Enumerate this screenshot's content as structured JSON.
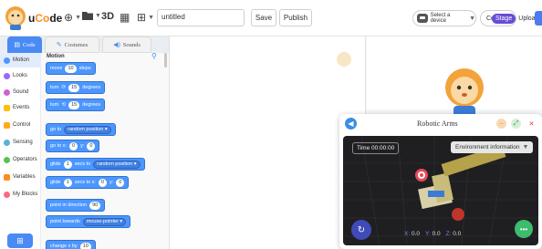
{
  "app": {
    "logo_prefix": "u",
    "logo_mid": "Co",
    "logo_suffix": "de"
  },
  "toolbar": {
    "view_3d_label": "3D",
    "project_title": "untitled",
    "save_label": "Save",
    "publish_label": "Publish",
    "device_label": "Select a device",
    "connect_label": "Connect",
    "mode_stage_label": "Stage",
    "mode_upload_label": "Upload"
  },
  "tabs": [
    {
      "label": "Code",
      "icon": "code-icon",
      "active": true
    },
    {
      "label": "Costumes",
      "icon": "brush-icon",
      "active": false
    },
    {
      "label": "Sounds",
      "icon": "speaker-icon",
      "active": false
    }
  ],
  "categories": [
    {
      "label": "Motion",
      "color": "#4c97ff",
      "active": true
    },
    {
      "label": "Looks",
      "color": "#9966ff",
      "active": false
    },
    {
      "label": "Sound",
      "color": "#cf63cf",
      "active": false
    },
    {
      "label": "Events",
      "color": "#ffbf00",
      "active": false
    },
    {
      "label": "Control",
      "color": "#ffab19",
      "active": false
    },
    {
      "label": "Sensing",
      "color": "#5cb1d6",
      "active": false
    },
    {
      "label": "Operators",
      "color": "#59c059",
      "active": false
    },
    {
      "label": "Variables",
      "color": "#ff8c1a",
      "active": false
    },
    {
      "label": "My Blocks",
      "color": "#ff6680",
      "active": false
    }
  ],
  "palette": {
    "header": "Motion",
    "blocks": {
      "move": {
        "text1": "move",
        "value": "10",
        "text2": "steps"
      },
      "turn_right": {
        "text1": "turn",
        "icon": "⟳",
        "value": "15",
        "text2": "degrees"
      },
      "turn_left": {
        "text1": "turn",
        "icon": "⟲",
        "value": "15",
        "text2": "degrees"
      },
      "goto": {
        "text1": "go to",
        "dropdown": "random position"
      },
      "goto_xy": {
        "text1": "go to x:",
        "x": "0",
        "text2": "y:",
        "y": "0"
      },
      "glide_to": {
        "text1": "glide",
        "secs": "1",
        "text2": "secs to",
        "dropdown": "random position"
      },
      "glide_xy": {
        "text1": "glide",
        "secs": "1",
        "text2": "secs to x:",
        "x": "0",
        "text3": "y:",
        "y": "0"
      },
      "point_dir": {
        "text1": "point in direction",
        "value": "90"
      },
      "point_towards": {
        "text1": "point towards",
        "dropdown": "mouse-pointer"
      },
      "change_x": {
        "text1": "change x by",
        "value": "10"
      }
    }
  },
  "robot_panel": {
    "title": "Robotic Arms",
    "time_text": "Time 00:00:00",
    "env_label": "Environment information",
    "coords": {
      "x_label": "X:",
      "x_value": "0.0",
      "y_label": "Y:",
      "y_value": "0.0",
      "z_label": "Z:",
      "z_value": "0.0"
    }
  },
  "colors": {
    "accent": "#4a8af4",
    "motion": "#4c97ff",
    "stage_mode": "#6a4bd8"
  }
}
